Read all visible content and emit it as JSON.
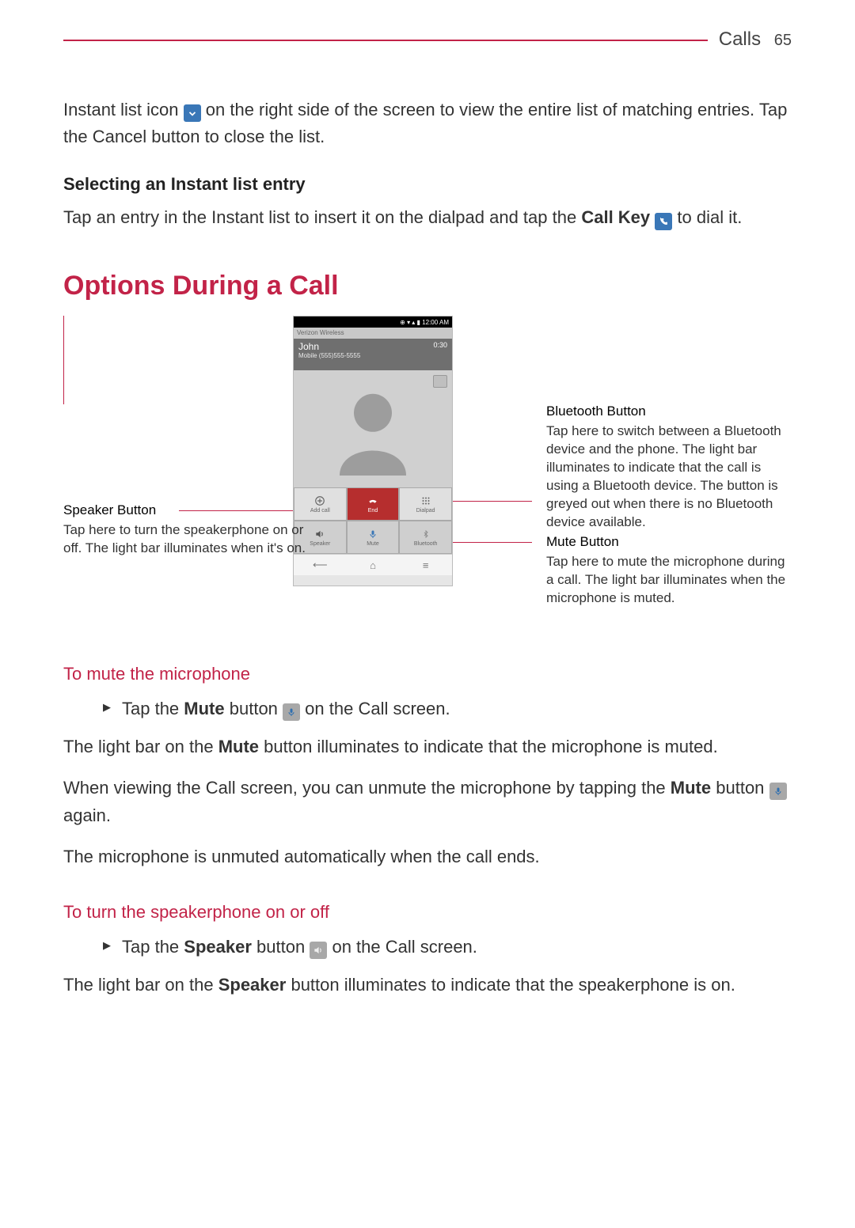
{
  "header": {
    "section": "Calls",
    "page_number": "65"
  },
  "intro": {
    "part1": "Instant list icon",
    "part2": "on the right side of the screen to view the entire list of matching entries. Tap the Cancel button to close the list."
  },
  "select_entry": {
    "heading": "Selecting an Instant list entry",
    "sentence_a": "Tap an entry in the Instant list to insert it on the dialpad and tap the",
    "call_key": "Call Key",
    "sentence_b": "to dial it."
  },
  "options_heading": "Options During a Call",
  "phone": {
    "time": "12:00 AM",
    "carrier": "Verizon Wireless",
    "contact": "John",
    "contact_sub": "Mobile (555)555-5555",
    "duration": "0:30",
    "btn_addcall": "Add call",
    "btn_end": "End",
    "btn_dialpad": "Dialpad",
    "btn_speaker": "Speaker",
    "btn_mute": "Mute",
    "btn_bluetooth": "Bluetooth"
  },
  "callouts": {
    "speaker_title": "Speaker Button",
    "speaker_body": "Tap here to turn the speakerphone on or off. The light bar illuminates when it's on.",
    "bluetooth_title": "Bluetooth Button",
    "bluetooth_body": "Tap here to switch between a Bluetooth device and the phone. The light bar illuminates to indicate that the call is using a Bluetooth device. The button is greyed out when there is no Bluetooth device available.",
    "mute_title": "Mute Button",
    "mute_body": "Tap here to mute the microphone during a call. The light bar illuminates when the microphone is muted."
  },
  "mute_section": {
    "heading": "To mute the microphone",
    "bullet_a": "Tap the",
    "bullet_mute_word": "Mute",
    "bullet_b": "button",
    "bullet_c": "on the Call screen.",
    "p1_a": "The light bar on the",
    "p1_mute": "Mute",
    "p1_b": "button illuminates to indicate that the microphone is muted.",
    "p2_a": "When viewing the Call screen, you can unmute the microphone by tapping the",
    "p2_mute": "Mute",
    "p2_b": "button",
    "p2_c": "again.",
    "p3": "The microphone is unmuted automatically when the call ends."
  },
  "speaker_section": {
    "heading": "To turn the speakerphone on or off",
    "bullet_a": "Tap the",
    "bullet_word": "Speaker",
    "bullet_b": "button",
    "bullet_c": "on the Call screen.",
    "p1_a": "The light bar on the",
    "p1_word": "Speaker",
    "p1_b": "button illuminates to indicate that the speakerphone is on."
  }
}
